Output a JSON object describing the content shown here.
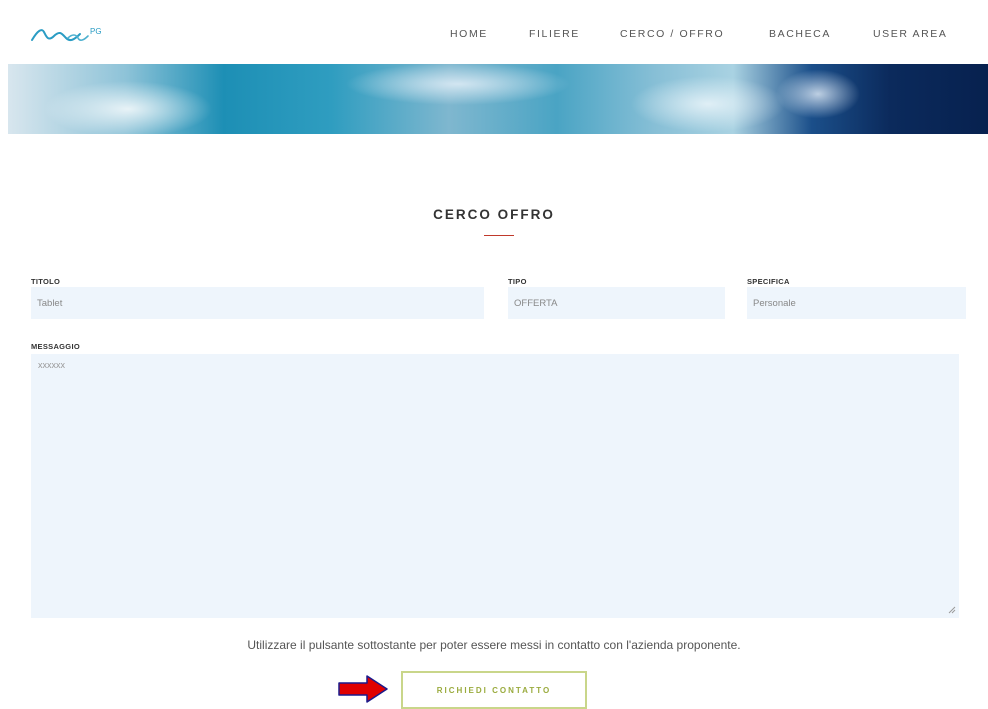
{
  "header": {
    "nav": [
      {
        "label": "HOME"
      },
      {
        "label": "FILIERE"
      },
      {
        "label": "CERCO / OFFRO"
      },
      {
        "label": "BACHECA"
      },
      {
        "label": "USER AREA"
      }
    ]
  },
  "section": {
    "title": "CERCO OFFRO"
  },
  "form": {
    "titolo": {
      "label": "TITOLO",
      "value": "Tablet"
    },
    "tipo": {
      "label": "TIPO",
      "value": "OFFERTA"
    },
    "specifica": {
      "label": "SPECIFICA",
      "value": "Personale"
    },
    "messaggio": {
      "label": "MESSAGGIO",
      "value": "xxxxxx"
    }
  },
  "notice": "Utilizzare il pulsante sottostante per poter essere messi in contatto con l'azienda proponente.",
  "cta": {
    "label": "RICHIEDI CONTATTO"
  },
  "colors": {
    "accent_red": "#c0392b",
    "field_bg": "#eef5fc",
    "button_border": "#c9d68a",
    "button_text": "#9aab3e",
    "annotation_arrow": "#e00000"
  },
  "icons": [
    "logo-icon",
    "resize-handle-icon",
    "red-arrow-icon"
  ]
}
